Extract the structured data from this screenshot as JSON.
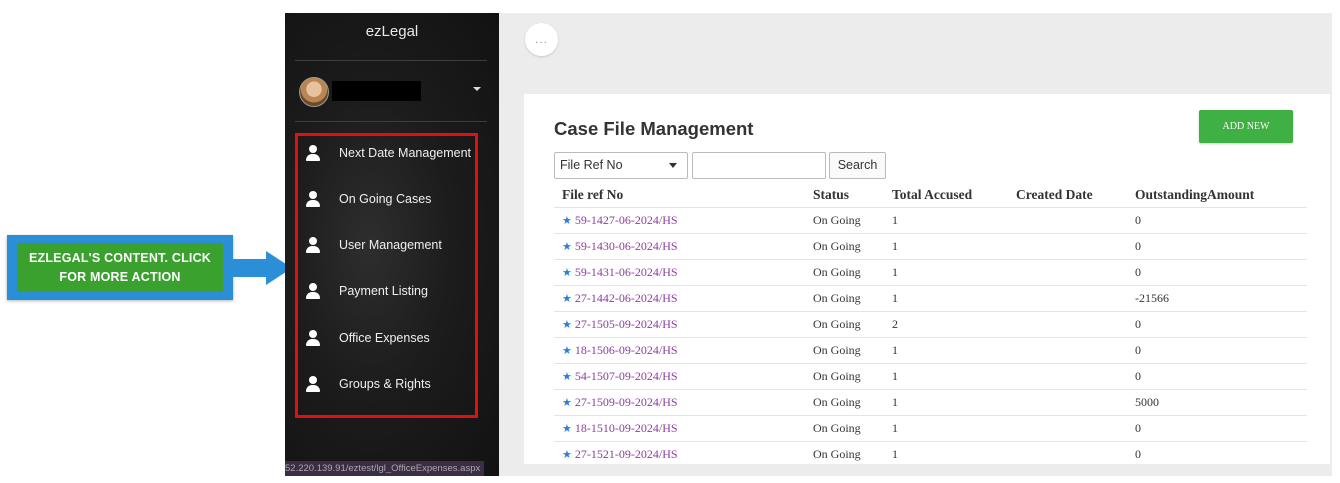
{
  "callout": {
    "text": "EZLEGAL'S CONTENT. CLICK FOR MORE ACTION"
  },
  "sidebar": {
    "brand": "ezLegal",
    "items": [
      {
        "label": "Next Date Management"
      },
      {
        "label": "On Going Cases"
      },
      {
        "label": "User Management"
      },
      {
        "label": "Payment Listing"
      },
      {
        "label": "Office Expenses"
      },
      {
        "label": "Groups & Rights"
      }
    ],
    "status_url": "52.220.139.91/eztest/lgl_OfficeExpenses.aspx"
  },
  "header": {
    "menu_dots": "..."
  },
  "main": {
    "title": "Case File Management",
    "add_button": "ADD NEW",
    "filter": {
      "selected": "File Ref No",
      "search_value": "",
      "search_button": "Search"
    },
    "columns": [
      "File ref No",
      "Status",
      "Total Accused",
      "Created Date",
      "OutstandingAmount"
    ],
    "rows": [
      {
        "ref": "59-1427-06-2024/HS",
        "status": "On Going",
        "accused": "1",
        "created": "",
        "amount": "0"
      },
      {
        "ref": "59-1430-06-2024/HS",
        "status": "On Going",
        "accused": "1",
        "created": "",
        "amount": "0"
      },
      {
        "ref": "59-1431-06-2024/HS",
        "status": "On Going",
        "accused": "1",
        "created": "",
        "amount": "0"
      },
      {
        "ref": "27-1442-06-2024/HS",
        "status": "On Going",
        "accused": "1",
        "created": "",
        "amount": "-21566"
      },
      {
        "ref": "27-1505-09-2024/HS",
        "status": "On Going",
        "accused": "2",
        "created": "",
        "amount": "0"
      },
      {
        "ref": "18-1506-09-2024/HS",
        "status": "On Going",
        "accused": "1",
        "created": "",
        "amount": "0"
      },
      {
        "ref": "54-1507-09-2024/HS",
        "status": "On Going",
        "accused": "1",
        "created": "",
        "amount": "0"
      },
      {
        "ref": "27-1509-09-2024/HS",
        "status": "On Going",
        "accused": "1",
        "created": "",
        "amount": "5000"
      },
      {
        "ref": "18-1510-09-2024/HS",
        "status": "On Going",
        "accused": "1",
        "created": "",
        "amount": "0"
      },
      {
        "ref": "27-1521-09-2024/HS",
        "status": "On Going",
        "accused": "1",
        "created": "",
        "amount": "0"
      }
    ]
  },
  "colors": {
    "highlight_border": "#e01010",
    "callout_blue": "#2a8fd6",
    "callout_green": "#3aa12f",
    "add_button": "#3fb043",
    "link": "#8e3ca0",
    "star": "#2a7fd6"
  },
  "icons": {
    "menu_item": "person-icon",
    "favorite": "star-icon"
  }
}
